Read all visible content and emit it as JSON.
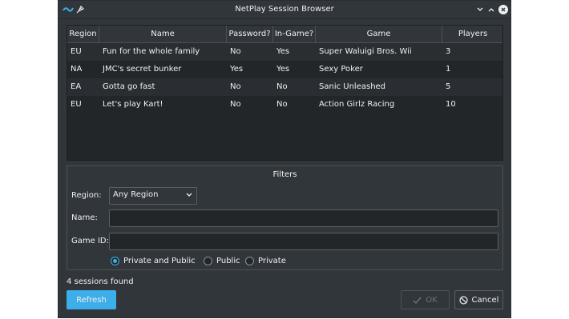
{
  "window": {
    "title": "NetPlay Session Browser"
  },
  "table": {
    "columns": [
      "Region",
      "Name",
      "Password?",
      "In-Game?",
      "Game",
      "Players"
    ],
    "rows": [
      [
        "EU",
        "Fun for the whole family",
        "No",
        "Yes",
        "Super Waluigi Bros. Wii",
        "3"
      ],
      [
        "NA",
        "JMC's secret bunker",
        "Yes",
        "Yes",
        "Sexy Poker",
        "1"
      ],
      [
        "EA",
        "Gotta go fast",
        "No",
        "No",
        "Sanic Unleashed",
        "5"
      ],
      [
        "EU",
        "Let's play Kart!",
        "No",
        "No",
        "Action Girlz Racing",
        "10"
      ]
    ]
  },
  "filters": {
    "title": "Filters",
    "region_label": "Region:",
    "region_value": "Any Region",
    "name_label": "Name:",
    "name_value": "",
    "gameid_label": "Game ID:",
    "gameid_value": "",
    "visibility_options": [
      "Private and Public",
      "Public",
      "Private"
    ],
    "visibility_selected": "Private and Public"
  },
  "status": "4 sessions found",
  "buttons": {
    "refresh": "Refresh",
    "ok": "OK",
    "cancel": "Cancel"
  },
  "colors": {
    "background": "#31363b",
    "table_bg": "#232629",
    "accent": "#3daee9",
    "text": "#eff0f1"
  }
}
